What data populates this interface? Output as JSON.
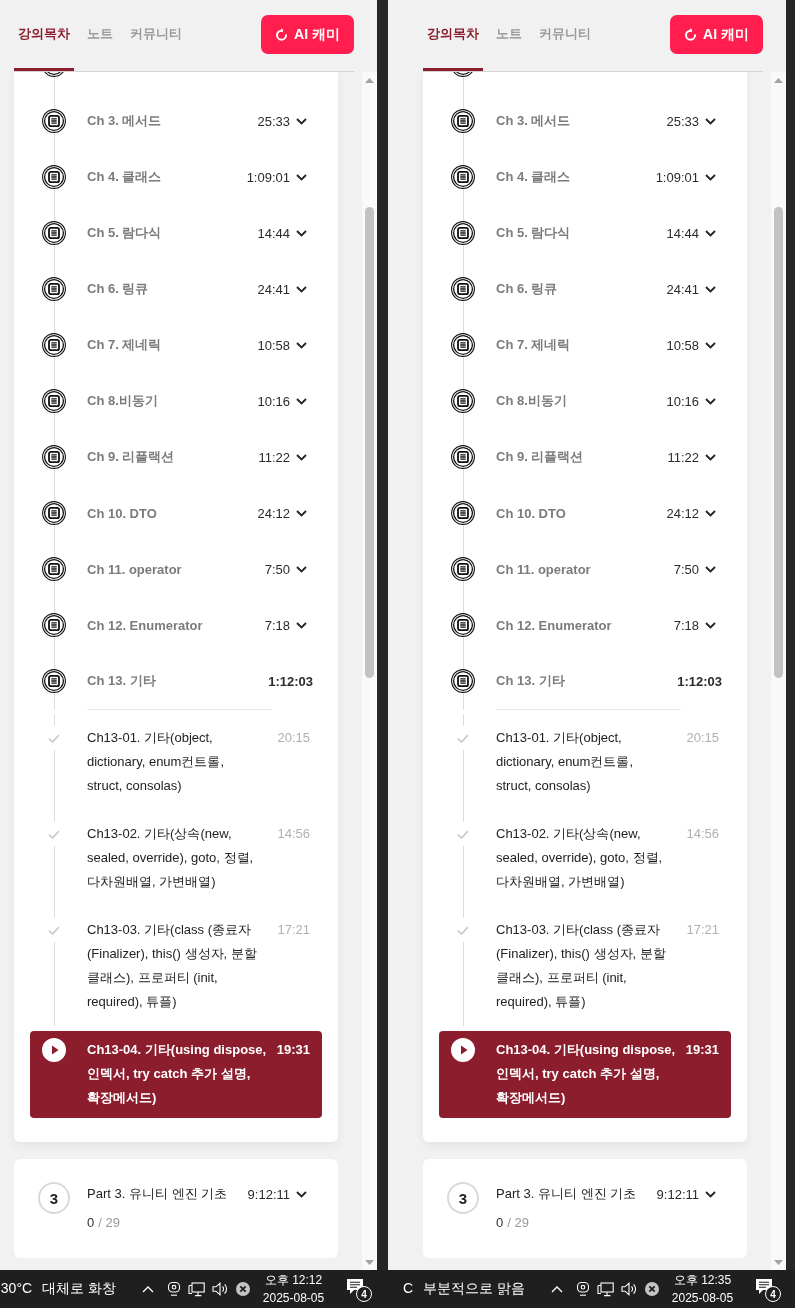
{
  "windows": [
    {
      "tabs": [
        {
          "label": "강의목차",
          "selected": true
        },
        {
          "label": "노트",
          "selected": false
        },
        {
          "label": "커뮤니티",
          "selected": false
        }
      ],
      "ai_button": "AI 캐미",
      "chapters": [
        {
          "title": "Ch 3. 메서드",
          "duration": "25:33",
          "expanded": false
        },
        {
          "title": "Ch 4. 클래스",
          "duration": "1:09:01",
          "expanded": false
        },
        {
          "title": "Ch 5. 람다식",
          "duration": "14:44",
          "expanded": false
        },
        {
          "title": "Ch 6. 링큐",
          "duration": "24:41",
          "expanded": false
        },
        {
          "title": "Ch 7. 제네릭",
          "duration": "10:58",
          "expanded": false
        },
        {
          "title": "Ch 8.비동기",
          "duration": "10:16",
          "expanded": false
        },
        {
          "title": "Ch 9. 리플랙션",
          "duration": "11:22",
          "expanded": false
        },
        {
          "title": "Ch 10. DTO",
          "duration": "24:12",
          "expanded": false
        },
        {
          "title": "Ch 11. operator",
          "duration": "7:50",
          "expanded": false
        },
        {
          "title": "Ch 12. Enumerator",
          "duration": "7:18",
          "expanded": false
        },
        {
          "title": "Ch 13. 기타",
          "duration": "1:12:03",
          "expanded": true,
          "lessons": [
            {
              "title": "Ch13-01. 기타(object, dictionary, enum컨트롤, struct, consolas)",
              "duration": "20:15",
              "completed": true,
              "selected": false
            },
            {
              "title": "Ch13-02. 기타(상속(new, sealed, override), goto, 정렬, 다차원배열, 가변배열)",
              "duration": "14:56",
              "completed": true,
              "selected": false
            },
            {
              "title": "Ch13-03. 기타(class (종료자 (Finalizer), this() 생성자, 분할 클래스), 프로퍼티 (init, required), 튜플)",
              "duration": "17:21",
              "completed": true,
              "selected": false
            },
            {
              "title": "Ch13-04. 기타(using dispose, 인덱서, try catch 추가 설명, 확장메서드)",
              "duration": "19:31",
              "completed": false,
              "selected": true
            }
          ]
        }
      ],
      "next_part": {
        "number": "3",
        "title": "Part 3. 유니티 엔진 기초",
        "duration": "9:12:11",
        "expanded": false,
        "completed_count": "0",
        "total": "/ 29"
      },
      "taskbar": {
        "temperature": "30°C",
        "weather": "대체로 화창",
        "time": "오후 12:12",
        "date": "2025-08-05",
        "notification_count": "4"
      }
    },
    {
      "tabs": [
        {
          "label": "강의목차",
          "selected": true
        },
        {
          "label": "노트",
          "selected": false
        },
        {
          "label": "커뮤니티",
          "selected": false
        }
      ],
      "ai_button": "AI 캐미",
      "chapters": [
        {
          "title": "Ch 3. 메서드",
          "duration": "25:33",
          "expanded": false
        },
        {
          "title": "Ch 4. 클래스",
          "duration": "1:09:01",
          "expanded": false
        },
        {
          "title": "Ch 5. 람다식",
          "duration": "14:44",
          "expanded": false
        },
        {
          "title": "Ch 6. 링큐",
          "duration": "24:41",
          "expanded": false
        },
        {
          "title": "Ch 7. 제네릭",
          "duration": "10:58",
          "expanded": false
        },
        {
          "title": "Ch 8.비동기",
          "duration": "10:16",
          "expanded": false
        },
        {
          "title": "Ch 9. 리플랙션",
          "duration": "11:22",
          "expanded": false
        },
        {
          "title": "Ch 10. DTO",
          "duration": "24:12",
          "expanded": false
        },
        {
          "title": "Ch 11. operator",
          "duration": "7:50",
          "expanded": false
        },
        {
          "title": "Ch 12. Enumerator",
          "duration": "7:18",
          "expanded": false
        },
        {
          "title": "Ch 13. 기타",
          "duration": "1:12:03",
          "expanded": true,
          "lessons": [
            {
              "title": "Ch13-01. 기타(object, dictionary, enum컨트롤, struct, consolas)",
              "duration": "20:15",
              "completed": true,
              "selected": false
            },
            {
              "title": "Ch13-02. 기타(상속(new, sealed, override), goto, 정렬, 다차원배열, 가변배열)",
              "duration": "14:56",
              "completed": true,
              "selected": false
            },
            {
              "title": "Ch13-03. 기타(class (종료자 (Finalizer), this() 생성자, 분할 클래스), 프로퍼티 (init, required), 튜플)",
              "duration": "17:21",
              "completed": true,
              "selected": false
            },
            {
              "title": "Ch13-04. 기타(using dispose, 인덱서, try catch 추가 설명, 확장메서드)",
              "duration": "19:31",
              "completed": false,
              "selected": true
            }
          ]
        }
      ],
      "next_part": {
        "number": "3",
        "title": "Part 3. 유니티 엔진 기초",
        "duration": "9:12:11",
        "expanded": false,
        "completed_count": "0",
        "total": "/ 29"
      },
      "taskbar": {
        "temperature": "C",
        "weather": "부분적으로 맑음",
        "time": "오후 12:35",
        "date": "2025-08-05",
        "notification_count": "4"
      }
    }
  ]
}
